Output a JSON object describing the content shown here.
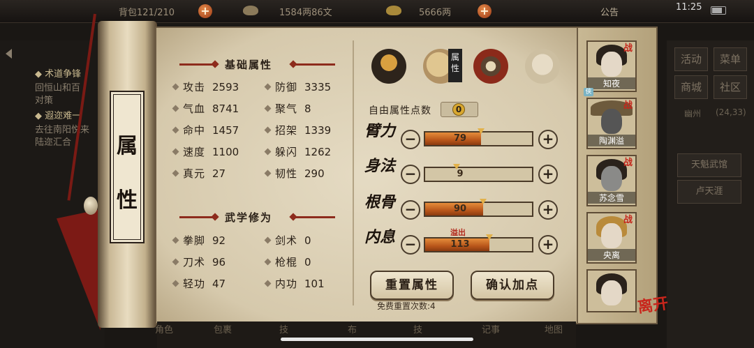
{
  "status_bar": {
    "time": "11:25",
    "capacity": "背包121/210",
    "money": "1584两86文",
    "gold": "5666两",
    "announcement": "公告"
  },
  "left_panel": {
    "quest1_title": "术道争锋",
    "quest1_desc1": "回恒山和百",
    "quest1_desc2": "对策",
    "quest2_title": "遐迩难一",
    "quest2_desc1": "去往南阳悦来",
    "quest2_desc2": "陆迩汇合"
  },
  "right_panel": {
    "activity": "活动",
    "menu": "菜单",
    "shop": "商城",
    "community": "社区",
    "location": "幽州",
    "coords": "(24,33)",
    "place1": "天魁武馆",
    "place2": "卢天涯"
  },
  "scroll_title": [
    "属",
    "性"
  ],
  "basic_attrs": {
    "title": "基础属性",
    "items": [
      {
        "label": "攻击",
        "value": "2593"
      },
      {
        "label": "防御",
        "value": "3335"
      },
      {
        "label": "气血",
        "value": "8741"
      },
      {
        "label": "聚气",
        "value": "8"
      },
      {
        "label": "命中",
        "value": "1457"
      },
      {
        "label": "招架",
        "value": "1339"
      },
      {
        "label": "速度",
        "value": "1100"
      },
      {
        "label": "躲闪",
        "value": "1262"
      },
      {
        "label": "真元",
        "value": "27"
      },
      {
        "label": "韧性",
        "value": "290"
      }
    ]
  },
  "martial": {
    "title": "武学修为",
    "items": [
      {
        "label": "拳脚",
        "value": "92"
      },
      {
        "label": "剑术",
        "value": "0"
      },
      {
        "label": "刀术",
        "value": "96"
      },
      {
        "label": "枪棍",
        "value": "0"
      },
      {
        "label": "轻功",
        "value": "47"
      },
      {
        "label": "内功",
        "value": "101"
      }
    ]
  },
  "tabs": {
    "attr_label": "属性"
  },
  "free_points": {
    "label": "自由属性点数",
    "value": "0"
  },
  "sliders": [
    {
      "label": "臂力",
      "value": 79,
      "fill": 0.52,
      "minus": "−",
      "plus": "+"
    },
    {
      "label": "身法",
      "value": 9,
      "fill": 0.0,
      "minus": "−",
      "plus": "+"
    },
    {
      "label": "根骨",
      "value": 90,
      "fill": 0.54,
      "minus": "−",
      "plus": "+"
    },
    {
      "label": "内息",
      "value": 113,
      "fill": 0.6,
      "minus": "−",
      "plus": "+"
    }
  ],
  "overflow_label": "溢出",
  "buttons": {
    "reset": "重置属性",
    "confirm": "确认加点"
  },
  "reset_count": "免费重置次数:4",
  "party": [
    {
      "name": "知夜",
      "battle": "战",
      "role": "侠"
    },
    {
      "name": "陶渊溢",
      "battle": "战",
      "role": ""
    },
    {
      "name": "苏念雪",
      "battle": "战",
      "role": ""
    },
    {
      "name": "央离",
      "battle": "战",
      "role": ""
    },
    {
      "name": "",
      "battle": "",
      "role": ""
    }
  ],
  "leave": "离开",
  "bottom_nav": [
    "角色",
    "包裹",
    "技",
    "布",
    "技",
    "记事",
    "地图"
  ],
  "colors": {
    "accent_red": "#8d2b1c",
    "bar_fill": "#d56f22",
    "paper": "#ddd1b6"
  }
}
